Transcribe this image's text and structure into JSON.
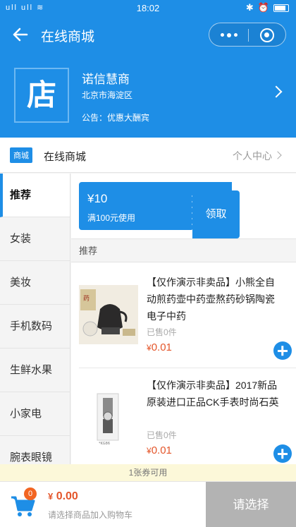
{
  "status_bar": {
    "time": "18:02",
    "left_icons": "ull ull ≋"
  },
  "title_bar": {
    "title": "在线商城"
  },
  "store": {
    "logo_text": "店",
    "name": "诺信慧商",
    "address": "北京市海淀区",
    "notice": "公告：优惠大酬宾"
  },
  "nav": {
    "badge": "商城",
    "title": "在线商城",
    "user_center": "个人中心"
  },
  "categories": [
    {
      "label": "推荐",
      "active": true
    },
    {
      "label": "女装"
    },
    {
      "label": "美妆"
    },
    {
      "label": "手机数码"
    },
    {
      "label": "生鲜水果"
    },
    {
      "label": "小家电"
    },
    {
      "label": "腕表眼镜"
    }
  ],
  "coupon": {
    "amount": "¥10",
    "condition": "满100元使用",
    "claim_label": "领取"
  },
  "section": {
    "title": "推荐"
  },
  "products": [
    {
      "title": "【仅作演示非卖品】小熊全自动煎药壶中药壶熬药砂锅陶瓷电子中药",
      "sold": "已售0件",
      "currency": "¥",
      "price": "0.01"
    },
    {
      "title": "【仅作演示非卖品】2017新品原装进口正品CK手表时尚石英",
      "sold": "已售0件",
      "currency": "¥",
      "price": "0.01"
    }
  ],
  "coupon_tip": "1张券可用",
  "cart": {
    "count": "0",
    "currency": "¥",
    "total": "0.00",
    "hint": "请选择商品加入购物车",
    "checkout_label": "请选择"
  },
  "colors": {
    "brand": "#1e8ee6",
    "price": "#e4562b",
    "badge": "#f26522",
    "checkout_disabled": "#b3b3b3"
  }
}
